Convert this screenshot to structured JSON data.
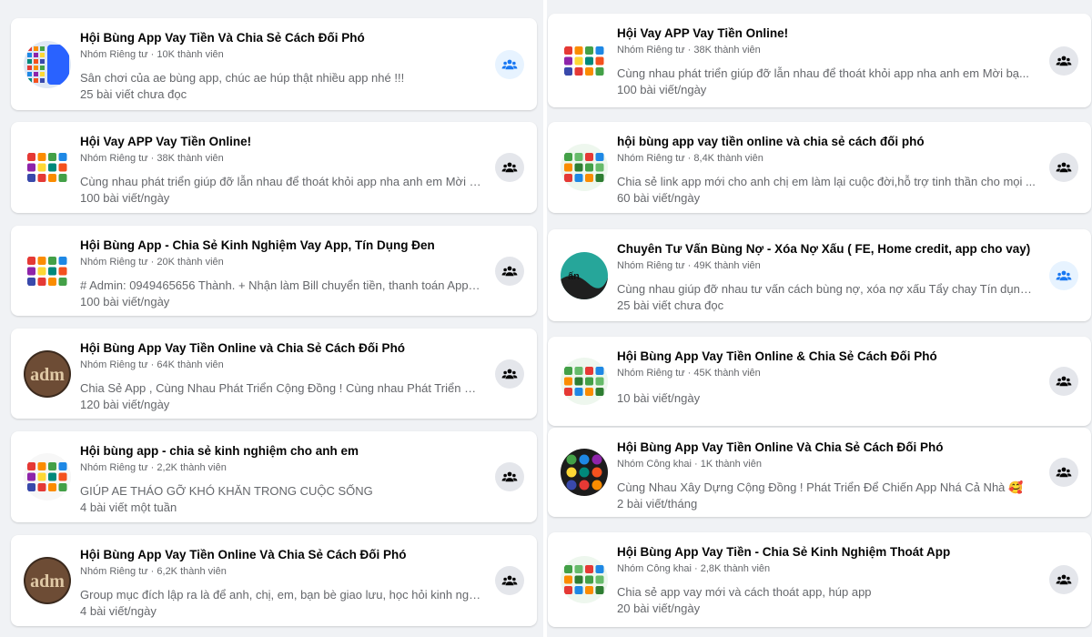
{
  "left": [
    {
      "title": "Hội Bùng App Vay Tiền Và Chia Sẻ Cách Đối Phó",
      "meta": "Nhóm Riêng tư · 10K thành viên",
      "desc": "Sân chơi của ae bùng app, chúc ae húp thật nhiều app nhé !!!",
      "posts": "25 bài viết chưa đọc",
      "avatar": "phone-apps",
      "btn": "blue"
    },
    {
      "title": "Hội Vay APP Vay Tiền Online!",
      "meta": "Nhóm Riêng tư · 38K thành viên",
      "desc": "Cùng nhau phát triển giúp đỡ lẫn nhau để thoát khỏi app nha anh em Mời bạ...",
      "posts": "100 bài viết/ngày",
      "avatar": "app-grid",
      "btn": "gray"
    },
    {
      "title": "Hội Bùng App - Chia Sẻ Kinh Nghiệm Vay App, Tín Dụng Đen",
      "meta": "Nhóm Riêng tư · 20K thành viên",
      "desc": "# Admin: 0949465656 Thành. + Nhận làm Bill chuyển tiền, thanh toán App + ...",
      "posts": "100 bài viết/ngày",
      "avatar": "app-grid",
      "btn": "gray"
    },
    {
      "title": "Hội Bùng App Vay Tiền Online và Chia Sẻ Cách Đối Phó",
      "meta": "Nhóm Riêng tư · 64K thành viên",
      "desc": "Chia Sẻ App , Cùng Nhau Phát Triển Cộng Đồng ! Cùng nhau Phát Triển Nhóm...",
      "posts": "120 bài viết/ngày",
      "avatar": "admin",
      "btn": "gray"
    },
    {
      "title": "Hội bùng app - chia sẻ kinh nghiệm cho anh em",
      "meta": "Nhóm Riêng tư · 2,2K thành viên",
      "desc": "GIÚP AE THÁO GỠ KHÓ KHĂN TRONG CUỘC SỐNG",
      "posts": "4 bài viết một tuần",
      "avatar": "app-grid-light",
      "btn": "gray"
    },
    {
      "title": "Hội Bùng App Vay Tiền Online Và Chia Sẻ Cách Đối Phó",
      "meta": "Nhóm Riêng tư · 6,2K thành viên",
      "desc": "Group mục đích lập ra là để anh, chị, em, bạn bè giao lưu, học hỏi kinh nghiệ...",
      "posts": "4 bài viết/ngày",
      "avatar": "admin",
      "btn": "gray"
    }
  ],
  "right": [
    {
      "title": "Hội Vay APP Vay Tiền Online!",
      "meta": "Nhóm Riêng tư · 38K thành viên",
      "desc": "Cùng nhau phát triển giúp đỡ lẫn nhau để thoát khỏi app nha anh em Mời bạ...",
      "posts": "100 bài viết/ngày",
      "avatar": "app-grid",
      "btn": "gray"
    },
    {
      "title": "hội bùng app vay tiền online và chia sẻ cách đối phó",
      "meta": "Nhóm Riêng tư · 8,4K thành viên",
      "desc": "Chia sẻ link app mới cho anh chị em làm lại cuộc đời,hỗ trợ tinh thần cho mọi ...",
      "posts": "60 bài viết/ngày",
      "avatar": "app-grid-green",
      "btn": "gray"
    },
    {
      "title": "Chuyên Tư Vấn Bùng Nợ - Xóa Nợ Xấu ( FE, Home credit, app cho vay)",
      "meta": "Nhóm Riêng tư · 49K thành viên",
      "desc": "Cùng nhau giúp đỡ nhau tư vấn cách bùng nợ, xóa nợ xấu Tẩy chay Tín dụng ...",
      "posts": "25 bài viết chưa đọc",
      "avatar": "teal",
      "btn": "blue"
    },
    {
      "title": "Hội Bùng App Vay Tiền Online & Chia Sẻ Cách Đối Phó",
      "meta": "Nhóm Riêng tư · 45K thành viên",
      "desc": "",
      "posts": "10 bài viết/ngày",
      "avatar": "app-grid-green",
      "btn": "gray"
    },
    {
      "title": "Hội Bùng App Vay Tiền Online Và Chia Sẻ Cách Đối Phó",
      "meta": "Nhóm Công khai · 1K thành viên",
      "desc": "Cùng Nhau Xây Dựng Cộng Đồng ! Phát Triển Để Chiến App Nhá Cả Nhà 🥰",
      "posts": "2 bài viết/tháng",
      "avatar": "dark-apps",
      "btn": "gray"
    },
    {
      "title": "Hội Bùng App Vay Tiền - Chia Sẻ Kinh Nghiệm Thoát App",
      "meta": "Nhóm Công khai · 2,8K thành viên",
      "desc": "Chia sẻ app vay mới và cách thoát app, húp app",
      "posts": "20 bài viết/ngày",
      "avatar": "app-grid-green",
      "btn": "gray"
    }
  ],
  "icons": {
    "join": "group-people-icon"
  },
  "colors": {
    "blue": "#1877f2",
    "gray_icon": "#050505",
    "blue_btn_bg": "#e7f3ff",
    "gray_btn_bg": "#e4e6eb"
  }
}
